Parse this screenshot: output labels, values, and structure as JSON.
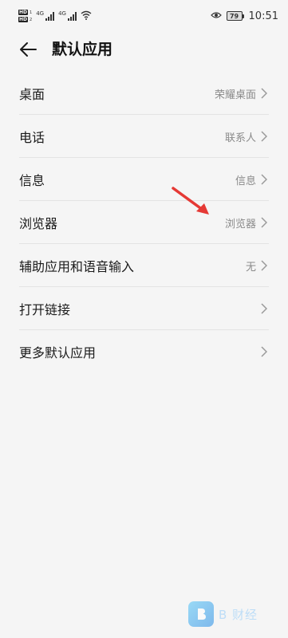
{
  "status_bar": {
    "hd1": "HD",
    "hd1_label": "1",
    "hd2": "HD",
    "hd2_label": "2",
    "sig1_label": "4G",
    "sig2_label": "4G",
    "battery": "79",
    "time": "10:51"
  },
  "header": {
    "title": "默认应用"
  },
  "list": {
    "items": [
      {
        "label": "桌面",
        "value": "荣耀桌面"
      },
      {
        "label": "电话",
        "value": "联系人"
      },
      {
        "label": "信息",
        "value": "信息"
      },
      {
        "label": "浏览器",
        "value": "浏览器"
      },
      {
        "label": "辅助应用和语音输入",
        "value": "无"
      },
      {
        "label": "打开链接",
        "value": ""
      },
      {
        "label": "更多默认应用",
        "value": ""
      }
    ]
  },
  "watermark": {
    "text": "B 财经"
  },
  "colors": {
    "background": "#f5f5f5",
    "annotation_arrow": "#e53935",
    "secondary_text": "#8a8a8a",
    "divider": "#e3e3e3"
  }
}
